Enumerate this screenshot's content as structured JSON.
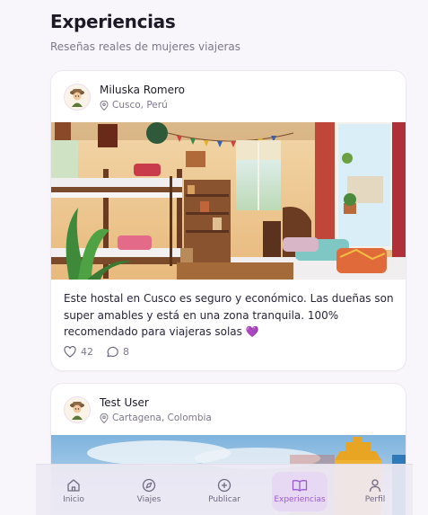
{
  "header": {
    "title": "Experiencias",
    "subtitle": "Reseñas reales de mujeres viajeras"
  },
  "posts": [
    {
      "author": "Miluska Romero",
      "location": "Cusco, Perú",
      "text": "Este hostal en Cusco es seguro y económico. Las dueñas son super amables y está en una zona tranquila. 100% recomendado para viajeras solas 💜",
      "likes": "42",
      "comments": "8"
    },
    {
      "author": "Test User",
      "location": "Cartagena, Colombia"
    }
  ],
  "nav": {
    "items": [
      {
        "label": "Inicio",
        "icon": "home-icon"
      },
      {
        "label": "Viajes",
        "icon": "compass-icon"
      },
      {
        "label": "Publicar",
        "icon": "plus-circle-icon"
      },
      {
        "label": "Experiencias",
        "icon": "book-icon",
        "active": true
      },
      {
        "label": "Perfil",
        "icon": "user-icon"
      }
    ]
  },
  "colors": {
    "accent": "#9a5ad2",
    "active_bg": "#e7d9f3",
    "background": "#f8f6fa"
  }
}
